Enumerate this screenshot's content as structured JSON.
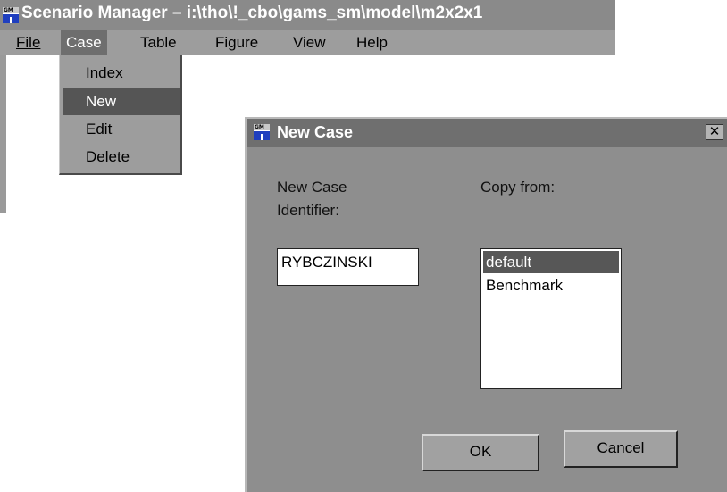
{
  "main_window": {
    "title": "Scenario Manager – i:\\tho\\!_cbo\\gams_sm\\model\\m2x2x1",
    "icon": "gm-app-icon"
  },
  "menubar": {
    "items": [
      {
        "label": "File"
      },
      {
        "label": "Case"
      },
      {
        "label": "Table"
      },
      {
        "label": "Figure"
      },
      {
        "label": "View"
      },
      {
        "label": "Help"
      }
    ]
  },
  "case_menu": {
    "items": [
      {
        "label": "Index"
      },
      {
        "label": "New"
      },
      {
        "label": "Edit"
      },
      {
        "label": "Delete"
      }
    ]
  },
  "dialog": {
    "title": "New Case",
    "close_glyph": "✕",
    "id_label_line1": "New Case",
    "id_label_line2": "Identifier:",
    "copy_label": "Copy from:",
    "id_value": "RYBCZINSKI",
    "copy_options": [
      "default",
      "Benchmark"
    ],
    "ok_label": "OK",
    "cancel_label": "Cancel"
  },
  "colors": {
    "titlebar": "#8a8a8a",
    "menubar": "#9d9d9d",
    "dialog_bg": "#8e8e8e",
    "highlight": "#555555",
    "icon_blue": "#1f3fbf"
  }
}
